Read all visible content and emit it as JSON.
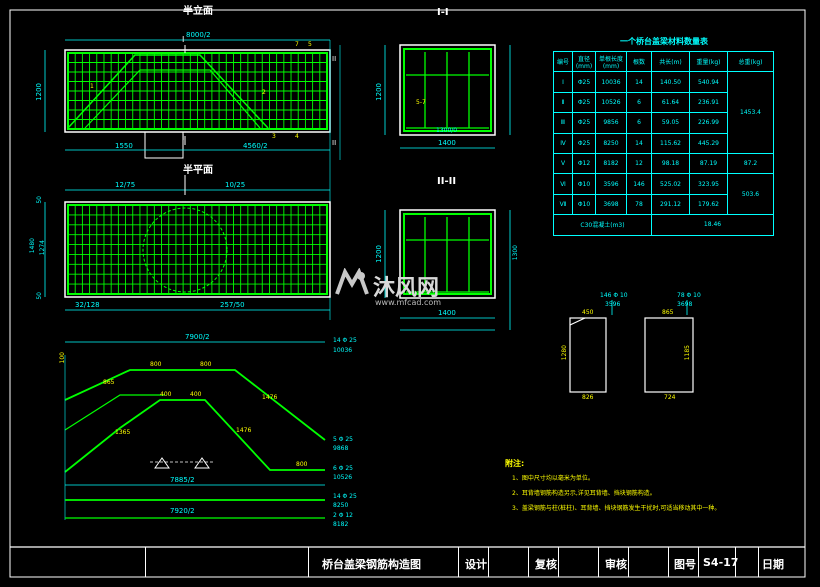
{
  "drawing": {
    "front_view": {
      "title": "半立面",
      "top_dim": "8000/2",
      "left_height": "1200",
      "bottom_left_dim": "1550",
      "bottom_right_dim": "4560/2",
      "section_mark_top": "I",
      "section_mark_bottom": "I",
      "section_mark_right_top": "II",
      "section_mark_right_bottom": "II",
      "bar_labels": [
        "7",
        "5",
        "1",
        "2",
        "3",
        "4"
      ]
    },
    "plan_view": {
      "title": "半平面",
      "top_left_dim": "12/75",
      "top_right_dim": "10/25",
      "left_dims": [
        "50",
        "1480",
        "1274",
        "50"
      ],
      "bottom_left_dim": "32/128",
      "bottom_right_dim": "257/50"
    },
    "section_1": {
      "title": "I-I",
      "width_dim": "1400",
      "height_dim": "1200",
      "inner_width": "1300/0",
      "bar_mark": "5-7"
    },
    "section_2": {
      "title": "II-II",
      "width_dim": "1400",
      "height_dim": "1200",
      "bar_mark": "1300"
    },
    "bar_shapes": {
      "top_total": "7900/2",
      "bar1_top": "14 Φ 25",
      "bar1_len": "10036",
      "bar1_seg": [
        "100",
        "800",
        "800",
        "865"
      ],
      "bar2_seg": [
        "400",
        "400",
        "1365",
        "1476",
        "1476",
        "800"
      ],
      "bar2_mark": "5 Φ 25",
      "bar2_len": "9868",
      "bar3_mark": "6 Φ 25",
      "bar3_len": "10526",
      "bottom_dim1": "7885/2",
      "bottom_dim2": "7920/2",
      "bar4_mark": "14 Φ 25",
      "bar4_len": "8250",
      "bar5_mark": "2 Φ 12",
      "bar5_len": "8182"
    },
    "stirrups": {
      "s1_mark": "146 Φ 10",
      "s1_len": "3596",
      "s1_top": "450",
      "s1_side": "1280",
      "s1_bottom": "826",
      "s2_mark": "78 Φ 10",
      "s2_len": "3698",
      "s2_top": "865",
      "s2_side": "1185",
      "s2_bottom": "724"
    },
    "notes": {
      "heading": "附注:",
      "items": [
        "1、图中尺寸均以毫米为单位。",
        "2、耳背墙钢筋构造另示,详见耳背墙、挡块钢筋构造。",
        "3、盖梁钢筋与柱(桩柱)、耳背墙、挡块钢筋发生干扰时,可适当移动其中一种。"
      ]
    }
  },
  "material_table": {
    "title": "一个桥台盖梁材料数量表",
    "headers": [
      "编号",
      "直径(mm)",
      "单根长度(mm)",
      "根数",
      "共长(m)",
      "重量(kg)",
      "总重(kg)"
    ],
    "rows": [
      [
        "Ⅰ",
        "Φ25",
        "10036",
        "14",
        "140.50",
        "540.94"
      ],
      [
        "Ⅱ",
        "Φ25",
        "10526",
        "6",
        "61.64",
        "236.91"
      ],
      [
        "Ⅲ",
        "Φ25",
        "9856",
        "6",
        "59.05",
        "226.99"
      ],
      [
        "Ⅳ",
        "Φ25",
        "8250",
        "14",
        "115.62",
        "445.29"
      ],
      [
        "Ⅴ",
        "Φ12",
        "8182",
        "12",
        "98.18",
        "87.19"
      ],
      [
        "Ⅵ",
        "Φ10",
        "3596",
        "146",
        "525.02",
        "323.95"
      ],
      [
        "Ⅶ",
        "Φ10",
        "3698",
        "78",
        "291.12",
        "179.62"
      ]
    ],
    "total_group1": "1453.4",
    "total_group2": "87.2",
    "total_group3": "503.6",
    "concrete_label": "C30混凝土(m3)",
    "concrete_value": "18.46"
  },
  "title_block": {
    "drawing_name": "桥台盖梁钢筋构造图",
    "design_label": "设计",
    "review_label": "复核",
    "approve_label": "审核",
    "drawing_no_label": "图号",
    "drawing_no": "S4-17",
    "date_label": "日期"
  },
  "watermark": {
    "brand": "沐风网",
    "url": "www.mfcad.com"
  },
  "colors": {
    "background": "#000000",
    "rebar": "#00ff00",
    "dimension": "#00ffff",
    "outline": "#ffffff",
    "label": "#ffff00"
  }
}
